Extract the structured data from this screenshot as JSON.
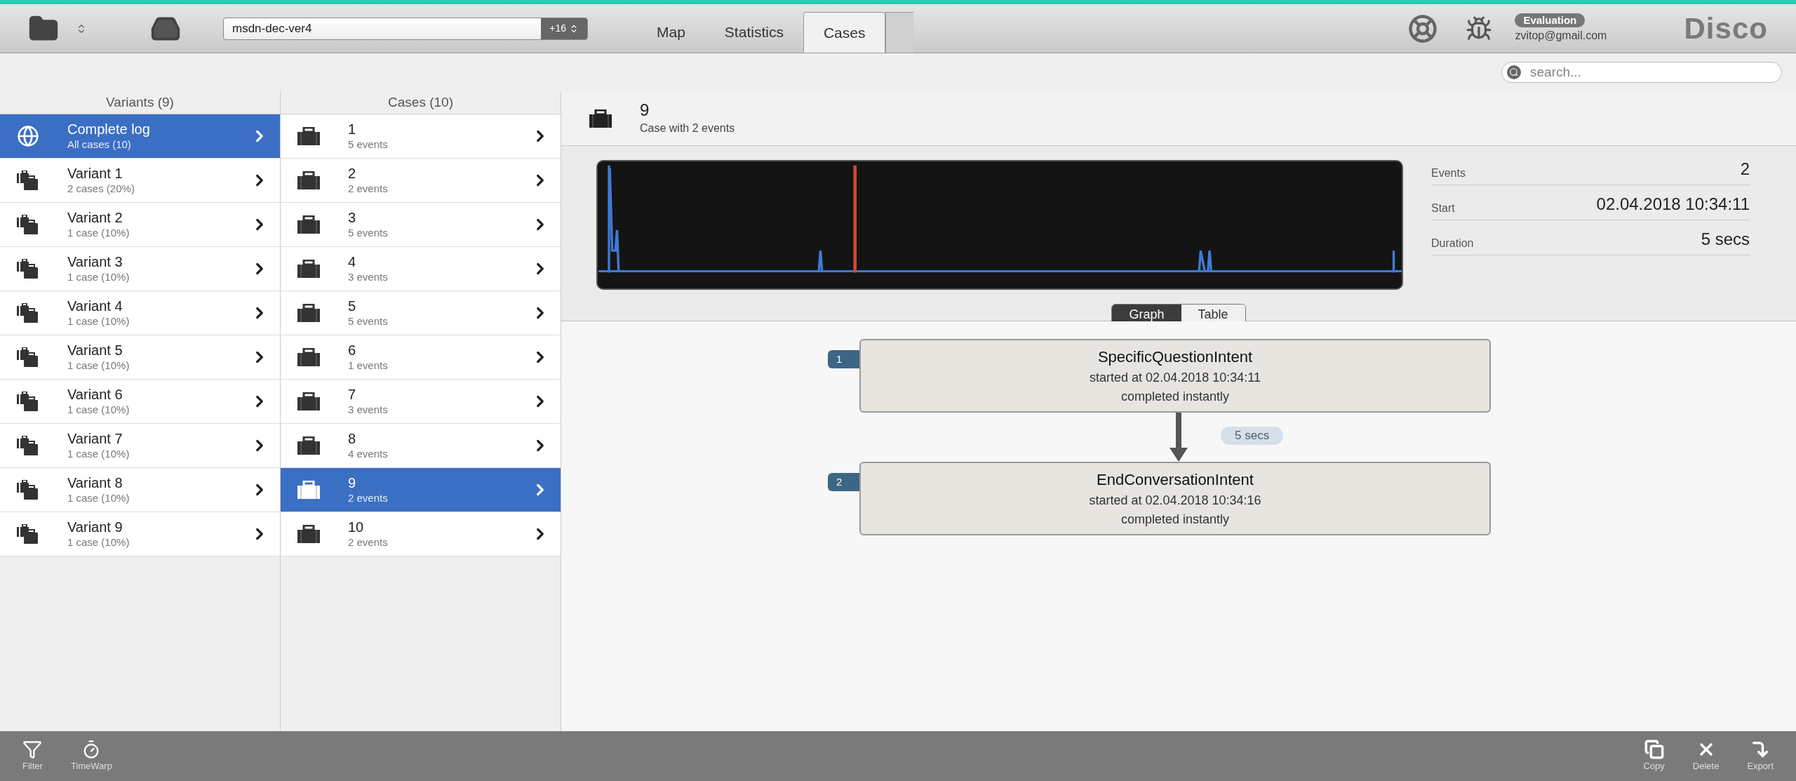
{
  "toolbar": {
    "dataset": "msdn-dec-ver4",
    "dataset_count": "+16",
    "tabs": [
      {
        "label": "Map",
        "selected": false
      },
      {
        "label": "Statistics",
        "selected": false
      },
      {
        "label": "Cases",
        "selected": true
      }
    ],
    "badge": "Evaluation",
    "user": "zvitop@gmail.com",
    "brand": "Disco"
  },
  "search": {
    "placeholder": "search..."
  },
  "variants": {
    "title": "Variants (9)",
    "items": [
      {
        "kind": "log",
        "name": "Complete log",
        "detail": "All cases (10)",
        "selected": true
      },
      {
        "kind": "variant",
        "name": "Variant 1",
        "detail": "2 cases (20%)",
        "selected": false
      },
      {
        "kind": "variant",
        "name": "Variant 2",
        "detail": "1 case (10%)",
        "selected": false
      },
      {
        "kind": "variant",
        "name": "Variant 3",
        "detail": "1 case (10%)",
        "selected": false
      },
      {
        "kind": "variant",
        "name": "Variant 4",
        "detail": "1 case (10%)",
        "selected": false
      },
      {
        "kind": "variant",
        "name": "Variant 5",
        "detail": "1 case (10%)",
        "selected": false
      },
      {
        "kind": "variant",
        "name": "Variant 6",
        "detail": "1 case (10%)",
        "selected": false
      },
      {
        "kind": "variant",
        "name": "Variant 7",
        "detail": "1 case (10%)",
        "selected": false
      },
      {
        "kind": "variant",
        "name": "Variant 8",
        "detail": "1 case (10%)",
        "selected": false
      },
      {
        "kind": "variant",
        "name": "Variant 9",
        "detail": "1 case (10%)",
        "selected": false
      }
    ]
  },
  "cases": {
    "title": "Cases (10)",
    "items": [
      {
        "name": "1",
        "detail": "5 events",
        "selected": false
      },
      {
        "name": "2",
        "detail": "2 events",
        "selected": false
      },
      {
        "name": "3",
        "detail": "5 events",
        "selected": false
      },
      {
        "name": "4",
        "detail": "3 events",
        "selected": false
      },
      {
        "name": "5",
        "detail": "5 events",
        "selected": false
      },
      {
        "name": "6",
        "detail": "1 events",
        "selected": false
      },
      {
        "name": "7",
        "detail": "3 events",
        "selected": false
      },
      {
        "name": "8",
        "detail": "4 events",
        "selected": false
      },
      {
        "name": "9",
        "detail": "2 events",
        "selected": true
      },
      {
        "name": "10",
        "detail": "2 events",
        "selected": false
      }
    ]
  },
  "case_detail": {
    "title": "9",
    "subtitle": "Case with 2 events",
    "stats": [
      {
        "label": "Events",
        "value": "2"
      },
      {
        "label": "Start",
        "value": "02.04.2018 10:34:11"
      },
      {
        "label": "Duration",
        "value": "5 secs"
      }
    ],
    "view_tabs": [
      {
        "label": "Graph",
        "selected": true
      },
      {
        "label": "Table",
        "selected": false
      }
    ],
    "events": [
      {
        "number": "1",
        "name": "SpecificQuestionIntent",
        "started": "started at 02.04.2018 10:34:11",
        "completed": "completed instantly"
      },
      {
        "number": "2",
        "name": "EndConversationIntent",
        "started": "started at 02.04.2018 10:34:16",
        "completed": "completed instantly"
      }
    ],
    "transitions": [
      "5 secs"
    ]
  },
  "bottom_bar": {
    "left": [
      "Filter",
      "TimeWarp"
    ],
    "right": [
      "Copy",
      "Delete",
      "Export"
    ]
  }
}
